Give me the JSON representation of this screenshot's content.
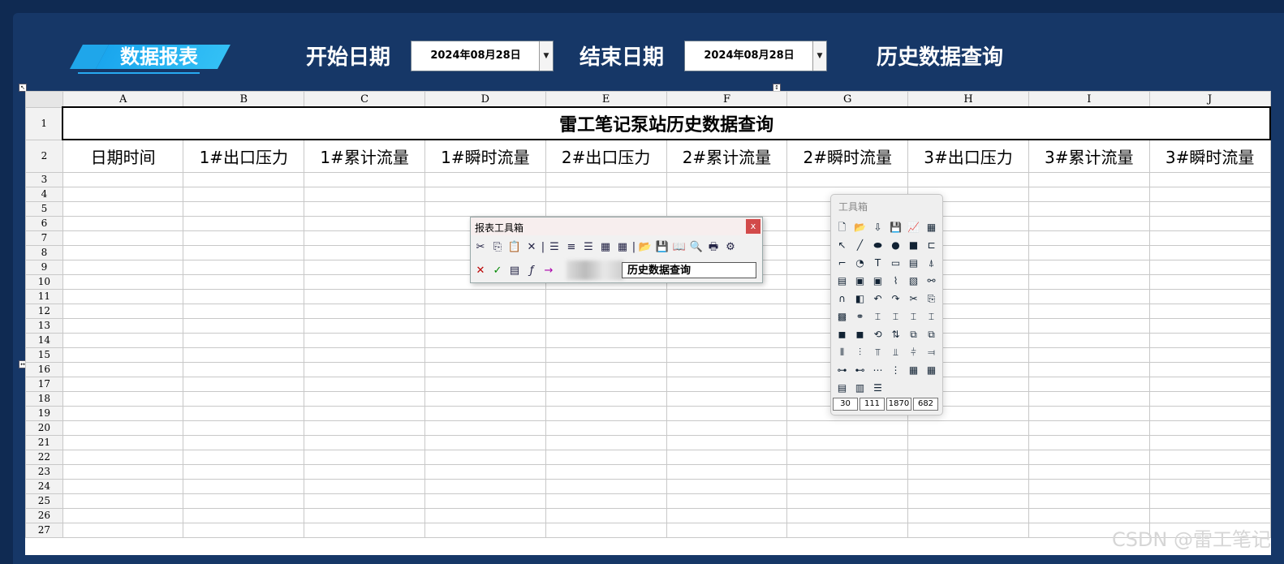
{
  "header": {
    "badge_label": "数据报表",
    "start_label": "开始日期",
    "start_value": "2024年08月28日",
    "end_label": "结束日期",
    "end_value": "2024年08月28日",
    "query_label": "历史数据查询"
  },
  "sheet": {
    "columns": [
      "A",
      "B",
      "C",
      "D",
      "E",
      "F",
      "G",
      "H",
      "I",
      "J"
    ],
    "title": "雷工笔记泵站历史数据查询",
    "headers": [
      "日期时间",
      "1#出口压力",
      "1#累计流量",
      "1#瞬时流量",
      "2#出口压力",
      "2#累计流量",
      "2#瞬时流量",
      "3#出口压力",
      "3#累计流量",
      "3#瞬时流量"
    ],
    "row_numbers": [
      "1",
      "2",
      "3",
      "4",
      "5",
      "6",
      "7",
      "8",
      "9",
      "10",
      "11",
      "12",
      "13",
      "14",
      "15",
      "16",
      "17",
      "18",
      "19",
      "20",
      "21",
      "22",
      "23",
      "24",
      "25",
      "26",
      "27"
    ]
  },
  "report_toolbox": {
    "title": "报表工具箱",
    "close": "x",
    "formula_text": "历史数据查询",
    "icons_row1": [
      "cut-icon",
      "copy-icon",
      "paste-icon",
      "delete-icon",
      "align-left-icon",
      "align-center-icon",
      "align-right-icon",
      "merge-icon",
      "grid-icon",
      "open-icon",
      "save-icon",
      "book-icon",
      "preview-icon",
      "print-icon",
      "settings-icon"
    ],
    "icons_row2": [
      "cancel-icon",
      "confirm-icon",
      "clipboard-icon",
      "function-icon"
    ]
  },
  "toolbox": {
    "title": "工具箱",
    "numbers": [
      "30",
      "111",
      "1870",
      "682"
    ]
  },
  "watermark": "CSDN @雷工笔记"
}
